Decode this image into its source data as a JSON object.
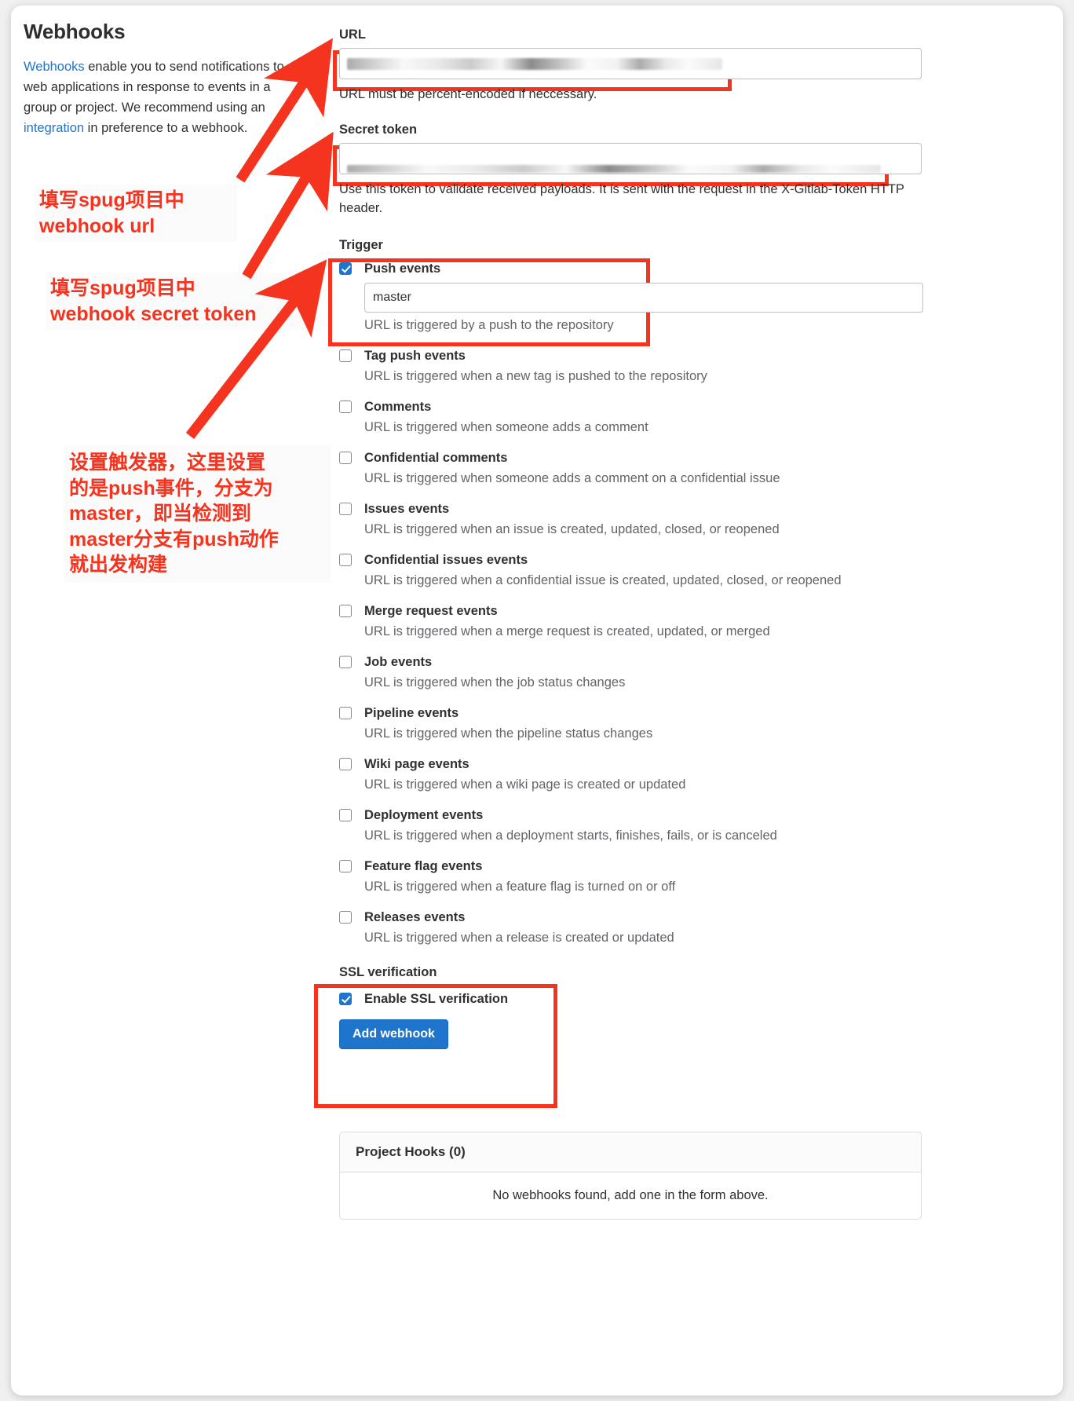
{
  "header": {
    "title": "Webhooks",
    "intro_link_1": "Webhooks",
    "intro_part_1": " enable you to send notifications to web applications in response to events in a group or project. We recommend using an ",
    "intro_link_2": "integration",
    "intro_part_2": " in preference to a webhook."
  },
  "annotations": {
    "url_note": "填写spug项目中\nwebhook url",
    "token_note": "填写spug项目中\nwebhook secret token",
    "trigger_note": "设置触发器，这里设置\n的是push事件，分支为\nmaster，即当检测到\nmaster分支有push动作\n就出发构建",
    "color": "#f5341f"
  },
  "form": {
    "url": {
      "label": "URL",
      "value": "",
      "redacted": true,
      "help": "URL must be percent-encoded if neccessary."
    },
    "secret_token": {
      "label": "Secret token",
      "value": "",
      "redacted": true,
      "help": "Use this token to validate received payloads. It is sent with the request in the X-Gitlab-Token HTTP header."
    },
    "trigger_label": "Trigger",
    "events": [
      {
        "label": "Push events",
        "desc": "URL is triggered by a push to the repository",
        "checked": true,
        "branch_value": "master",
        "branch_placeholder": "master"
      },
      {
        "label": "Tag push events",
        "desc": "URL is triggered when a new tag is pushed to the repository",
        "checked": false
      },
      {
        "label": "Comments",
        "desc": "URL is triggered when someone adds a comment",
        "checked": false
      },
      {
        "label": "Confidential comments",
        "desc": "URL is triggered when someone adds a comment on a confidential issue",
        "checked": false
      },
      {
        "label": "Issues events",
        "desc": "URL is triggered when an issue is created, updated, closed, or reopened",
        "checked": false
      },
      {
        "label": "Confidential issues events",
        "desc": "URL is triggered when a confidential issue is created, updated, closed, or reopened",
        "checked": false
      },
      {
        "label": "Merge request events",
        "desc": "URL is triggered when a merge request is created, updated, or merged",
        "checked": false
      },
      {
        "label": "Job events",
        "desc": "URL is triggered when the job status changes",
        "checked": false
      },
      {
        "label": "Pipeline events",
        "desc": "URL is triggered when the pipeline status changes",
        "checked": false
      },
      {
        "label": "Wiki page events",
        "desc": "URL is triggered when a wiki page is created or updated",
        "checked": false
      },
      {
        "label": "Deployment events",
        "desc": "URL is triggered when a deployment starts, finishes, fails, or is canceled",
        "checked": false
      },
      {
        "label": "Feature flag events",
        "desc": "URL is triggered when a feature flag is turned on or off",
        "checked": false
      },
      {
        "label": "Releases events",
        "desc": "URL is triggered when a release is created or updated",
        "checked": false
      }
    ],
    "ssl": {
      "title": "SSL verification",
      "checkbox_label": "Enable SSL verification",
      "checked": true
    },
    "submit_label": "Add webhook"
  },
  "hooks_panel": {
    "header": "Project Hooks (0)",
    "empty_message": "No webhooks found, add one in the form above."
  },
  "colors": {
    "accent": "#1f75cb",
    "annotation": "#f5341f",
    "link": "#1f75cb"
  }
}
